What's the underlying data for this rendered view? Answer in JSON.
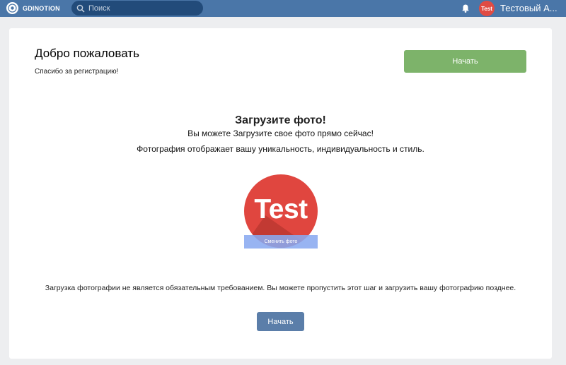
{
  "topbar": {
    "logo_text": "GDINOTION",
    "logo_icon": "globe-icon",
    "search_placeholder": "Поиск",
    "search_value": "",
    "notification_icon": "bell-icon",
    "avatar_text": "Test",
    "username": "Тестовый А..."
  },
  "welcome": {
    "title": "Добро пожаловать",
    "subtitle": "Спасибо за регистрацию!",
    "start_label": "Начать"
  },
  "upload": {
    "title": "Загрузите фото!",
    "line1": "Вы можете Загрузите свое фото прямо сейчас!",
    "line2": "Фотография отображает вашу уникальность, индивидуальность и стиль.",
    "photo_text": "Test",
    "change_photo_label": "Сменить фото",
    "note": "Загрузка фотографии не является обязательным требованием. Вы можете пропустить этот шаг и загрузить вашу фотографию позднее.",
    "start_label": "Начать"
  },
  "colors": {
    "topbar": "#4a76a8",
    "start_top": "#7db36a",
    "start_bottom": "#5b7ea9",
    "avatar": "#e0463f"
  }
}
